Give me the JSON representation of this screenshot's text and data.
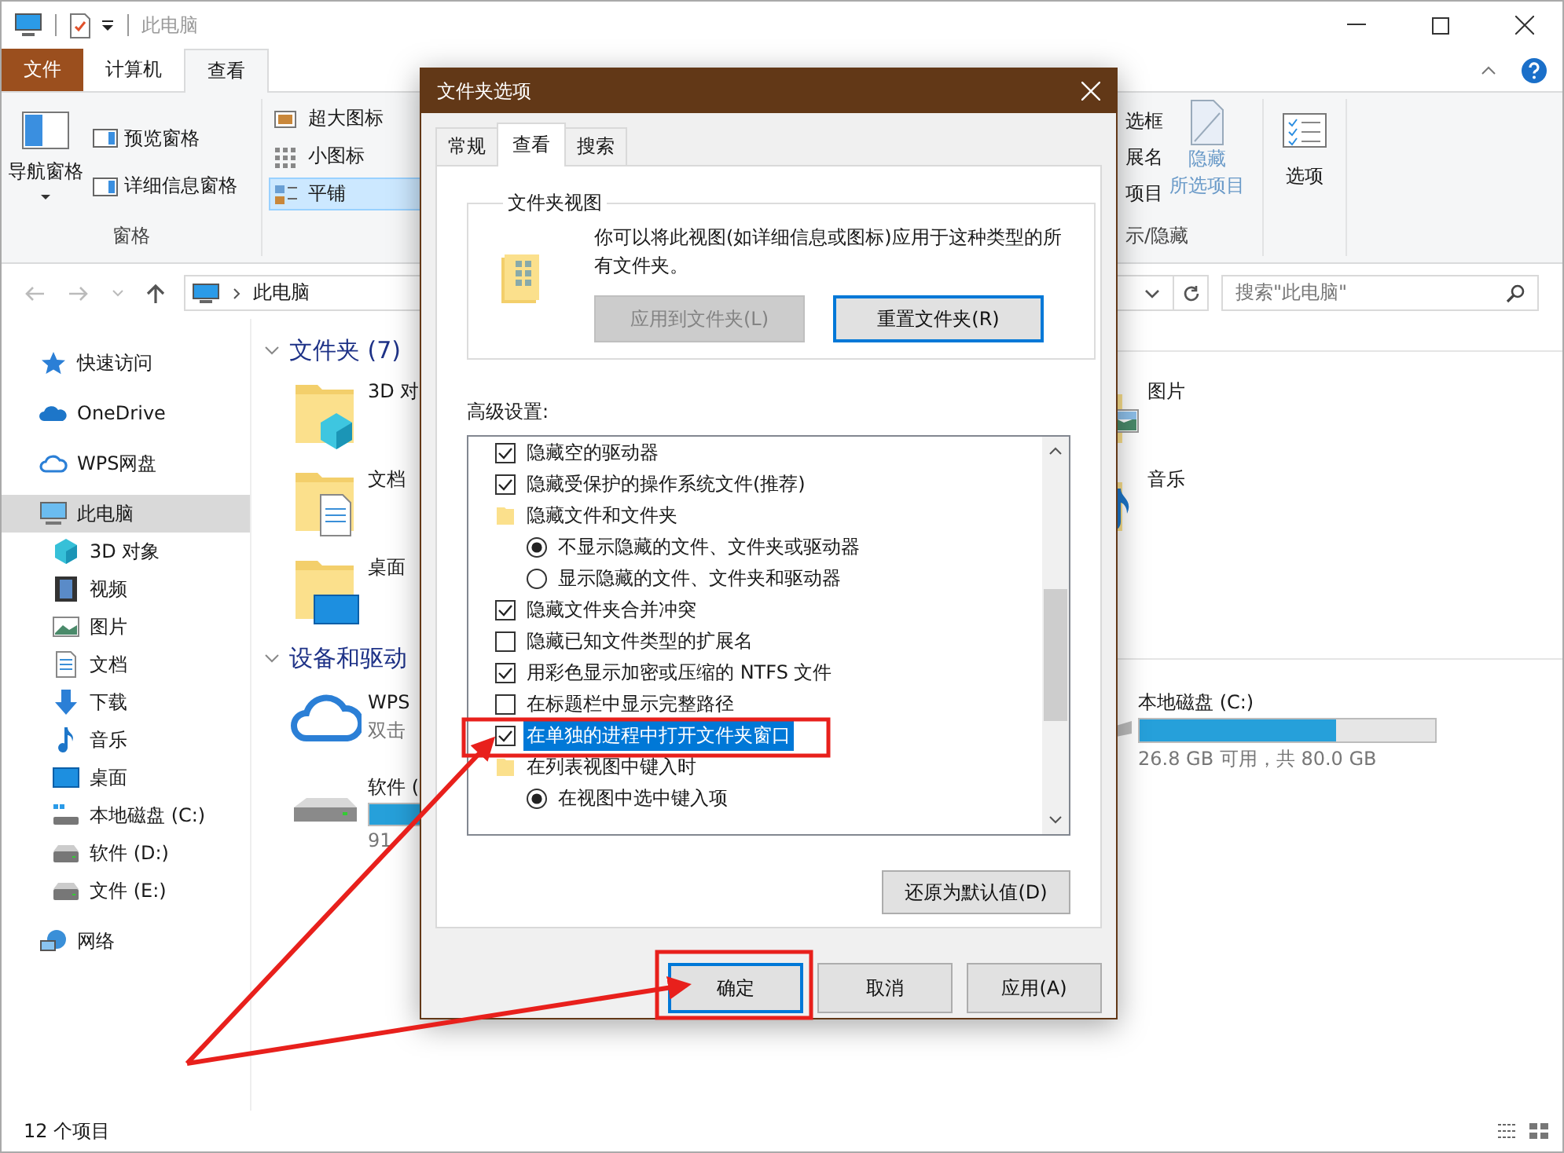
{
  "window": {
    "title": "此电脑"
  },
  "ribbon_tabs": [
    {
      "label": "文件",
      "kind": "file",
      "selected": false
    },
    {
      "label": "计算机",
      "kind": "tab",
      "selected": false
    },
    {
      "label": "查看",
      "kind": "tab",
      "selected": true
    }
  ],
  "ribbon": {
    "panes": {
      "nav_button": "导航窗格",
      "buttons": [
        "预览窗格",
        "详细信息窗格"
      ],
      "label": "窗格"
    },
    "layouts": [
      {
        "label": "超大图标",
        "kind": "large",
        "selected": false
      },
      {
        "label": "小图标",
        "kind": "small",
        "selected": false
      },
      {
        "label": "平铺",
        "kind": "tiles",
        "selected": true
      }
    ],
    "show_hide": {
      "items": [
        "选框",
        "展名",
        "项目"
      ],
      "hide_button": [
        "隐藏",
        "所选项目"
      ],
      "label": "示/隐藏"
    },
    "options_button": "选项"
  },
  "address": {
    "path": "此电脑",
    "search_placeholder": "搜索\"此电脑\""
  },
  "sidebar": {
    "items": [
      {
        "label": "快速访问",
        "kind": "star",
        "selected": false
      },
      {
        "label": "OneDrive",
        "kind": "onedrive",
        "selected": false
      },
      {
        "label": "WPS网盘",
        "kind": "cloud",
        "selected": false
      },
      {
        "label": "此电脑",
        "kind": "pc",
        "selected": true,
        "children": [
          {
            "label": "3D 对象",
            "kind": "cube",
            "selected": false
          },
          {
            "label": "视频",
            "kind": "video",
            "selected": false
          },
          {
            "label": "图片",
            "kind": "picture",
            "selected": false
          },
          {
            "label": "文档",
            "kind": "document",
            "selected": false
          },
          {
            "label": "下载",
            "kind": "download",
            "selected": false
          },
          {
            "label": "音乐",
            "kind": "music",
            "selected": false
          },
          {
            "label": "桌面",
            "kind": "desktop",
            "selected": false
          },
          {
            "label": "本地磁盘 (C:)",
            "kind": "sysdrive",
            "selected": false
          },
          {
            "label": "软件 (D:)",
            "kind": "drive",
            "selected": false
          },
          {
            "label": "文件 (E:)",
            "kind": "drive",
            "selected": false
          }
        ]
      },
      {
        "label": "网络",
        "kind": "network",
        "selected": false
      }
    ]
  },
  "folders": {
    "title": "文件夹 (7)",
    "left_items": [
      {
        "name": "3D 对",
        "kind": "cube"
      },
      {
        "name": "文档",
        "kind": "document"
      },
      {
        "name": "桌面",
        "kind": "desktop"
      }
    ],
    "right_items": [
      {
        "name": "图片",
        "kind": "picture"
      },
      {
        "name": "音乐",
        "kind": "music"
      }
    ]
  },
  "drives": {
    "title": "设备和驱动",
    "left_items": [
      {
        "name": "WPS",
        "detail": "双击",
        "kind": "cloud"
      },
      {
        "name": "软件 (",
        "detail": "91",
        "kind": "drive"
      }
    ],
    "right_items": [
      {
        "name": "本地磁盘 (C:)",
        "detail": "26.8 GB 可用，共 80.0 GB",
        "kind": "drive",
        "level": 0.665
      }
    ]
  },
  "status_bar": {
    "count": "12 个项目"
  },
  "dialog": {
    "title": "文件夹选项",
    "tabs": [
      {
        "label": "常规",
        "selected": false
      },
      {
        "label": "查看",
        "selected": true
      },
      {
        "label": "搜索",
        "selected": false
      }
    ],
    "folder_views": {
      "title": "文件夹视图",
      "description": "你可以将此视图(如详细信息或图标)应用于这种类型的所有文件夹。",
      "buttons": [
        {
          "label": "应用到文件夹(L)",
          "disabled": true
        },
        {
          "label": "重置文件夹(R)",
          "disabled": false
        }
      ]
    },
    "advanced_label": "高级设置:",
    "settings": [
      {
        "kind": "checkbox",
        "label": "隐藏空的驱动器",
        "checked": true,
        "selected": false
      },
      {
        "kind": "checkbox",
        "label": "隐藏受保护的操作系统文件(推荐)",
        "checked": true,
        "selected": false
      },
      {
        "kind": "folder",
        "label": "隐藏文件和文件夹",
        "selected": false,
        "children": [
          {
            "kind": "radio",
            "label": "不显示隐藏的文件、文件夹或驱动器",
            "checked": true,
            "selected": false
          },
          {
            "kind": "radio",
            "label": "显示隐藏的文件、文件夹和驱动器",
            "checked": false,
            "selected": false
          }
        ]
      },
      {
        "kind": "checkbox",
        "label": "隐藏文件夹合并冲突",
        "checked": true,
        "selected": false
      },
      {
        "kind": "checkbox",
        "label": "隐藏已知文件类型的扩展名",
        "checked": false,
        "selected": false
      },
      {
        "kind": "checkbox",
        "label": "用彩色显示加密或压缩的 NTFS 文件",
        "checked": true,
        "selected": false
      },
      {
        "kind": "checkbox",
        "label": "在标题栏中显示完整路径",
        "checked": false,
        "selected": false
      },
      {
        "kind": "checkbox",
        "label": "在单独的进程中打开文件夹窗口",
        "checked": true,
        "selected": true
      },
      {
        "kind": "folder",
        "label": "在列表视图中键入时",
        "selected": false,
        "children": [
          {
            "kind": "radio",
            "label": "在视图中选中键入项",
            "checked": true,
            "selected": false
          }
        ]
      }
    ],
    "restore_button": "还原为默认值(D)",
    "buttons": [
      "确定",
      "取消",
      "应用(A)"
    ]
  }
}
